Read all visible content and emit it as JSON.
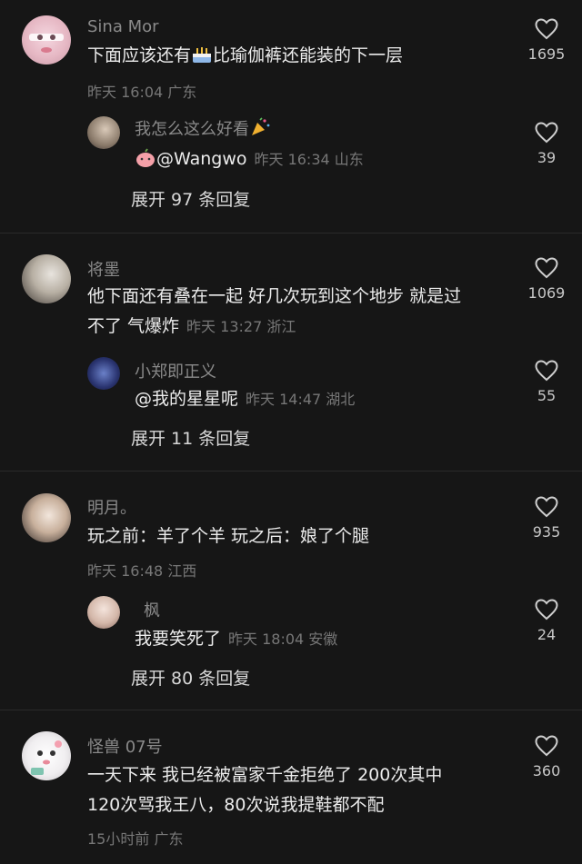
{
  "comments": [
    {
      "author": "Sina Mor",
      "text_a": "下面应该还有",
      "text_b": "比瑜伽裤还能装的下一层",
      "meta": "昨天 16:04 广东",
      "likes": "1695",
      "reply": {
        "author": "我怎么这么好看",
        "mention": "@Wangwo",
        "meta": "昨天 16:34 山东",
        "likes": "39"
      },
      "expand": "展开 97 条回复"
    },
    {
      "author": "将墨",
      "line1": "他下面还有叠在一起 好几次玩到这个地步 就是过",
      "line2": "不了 气爆炸",
      "meta": "昨天 13:27 浙江",
      "likes": "1069",
      "reply": {
        "author": "小郑即正义",
        "text": "@我的星星呢",
        "meta": "昨天 14:47 湖北",
        "likes": "55"
      },
      "expand": "展开 11 条回复"
    },
    {
      "author": "明月。",
      "text": "玩之前：羊了个羊 玩之后：娘了个腿",
      "meta": "昨天 16:48 江西",
      "likes": "935",
      "reply": {
        "author": "枫",
        "text": "我要笑死了",
        "meta": "昨天 18:04 安徽",
        "likes": "24"
      },
      "expand": "展开 80 条回复"
    },
    {
      "author": "怪兽 07号",
      "line1": "一天下来 我已经被富家千金拒绝了 200次其中",
      "line2": "120次骂我王八，80次说我提鞋都不配",
      "meta": "15小时前 广东",
      "likes": "360"
    }
  ],
  "colors": {
    "background": "#161616",
    "name": "#8a8a8a",
    "text": "#ececec",
    "meta": "#777777",
    "divider": "#2a2a2a"
  },
  "icons": [
    "heart-outline-icon",
    "cake-emoji",
    "party-popper-emoji",
    "peach-emoji"
  ]
}
